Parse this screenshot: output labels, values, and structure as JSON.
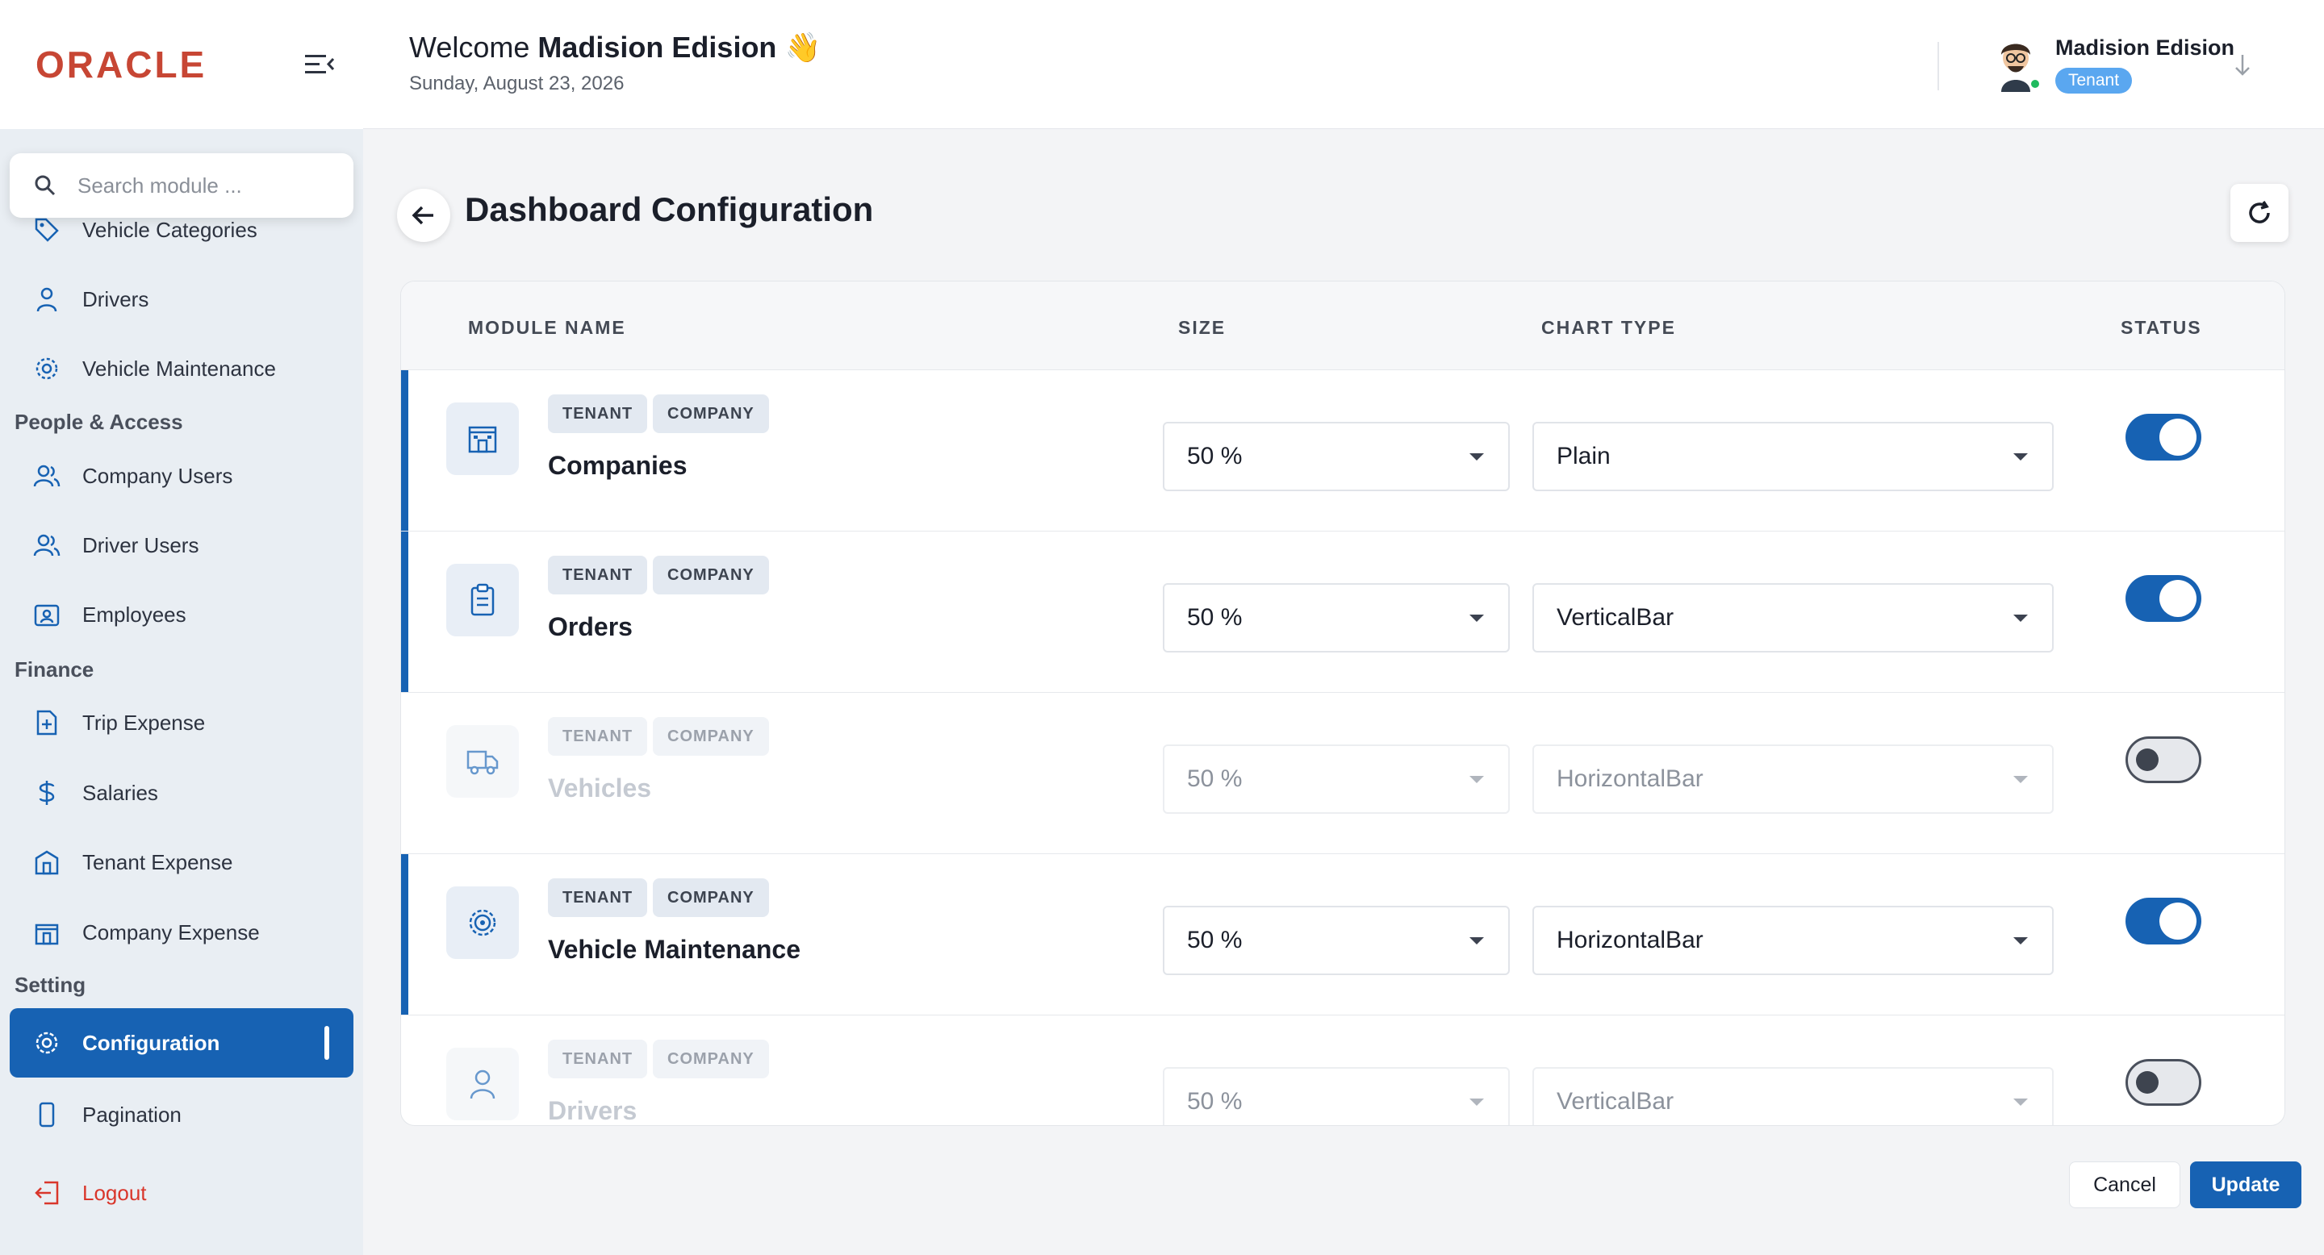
{
  "app": {
    "logo": "ORACLE"
  },
  "search": {
    "placeholder": "Search module ..."
  },
  "sidebar": {
    "items": [
      {
        "label": "Vehicle Categories",
        "icon": "tag-icon"
      },
      {
        "label": "Drivers",
        "icon": "user-icon"
      },
      {
        "label": "Vehicle Maintenance",
        "icon": "gear-icon"
      }
    ],
    "sections": {
      "people": "People & Access",
      "finance": "Finance",
      "setting": "Setting"
    },
    "people_items": [
      {
        "label": "Company Users",
        "icon": "users-icon"
      },
      {
        "label": "Driver Users",
        "icon": "users-icon"
      },
      {
        "label": "Employees",
        "icon": "id-card-icon"
      }
    ],
    "finance_items": [
      {
        "label": "Trip Expense",
        "icon": "file-plus-icon"
      },
      {
        "label": "Salaries",
        "icon": "dollar-icon"
      },
      {
        "label": "Tenant Expense",
        "icon": "building-icon"
      },
      {
        "label": "Company Expense",
        "icon": "building-icon"
      }
    ],
    "setting_items": [
      {
        "label": "Configuration",
        "icon": "settings-icon",
        "active": true
      },
      {
        "label": "Pagination",
        "icon": "phone-icon"
      }
    ],
    "logout": "Logout"
  },
  "header": {
    "welcome_prefix": "Welcome",
    "welcome_name": "Madision Edision",
    "wave": "👋",
    "date": "Sunday, August 23, 2026",
    "user_name": "Madision Edision",
    "user_role": "Tenant"
  },
  "page": {
    "title": "Dashboard Configuration"
  },
  "table": {
    "headers": {
      "module": "MODULE NAME",
      "size": "SIZE",
      "chart": "CHART TYPE",
      "status": "STATUS"
    },
    "rows": [
      {
        "name": "Companies",
        "tags": [
          "TENANT",
          "COMPANY"
        ],
        "size": "50 %",
        "chart": "Plain",
        "status": true,
        "icon": "building-icon"
      },
      {
        "name": "Orders",
        "tags": [
          "TENANT",
          "COMPANY"
        ],
        "size": "50 %",
        "chart": "VerticalBar",
        "status": true,
        "icon": "clipboard-icon"
      },
      {
        "name": "Vehicles",
        "tags": [
          "TENANT",
          "COMPANY"
        ],
        "size": "50 %",
        "chart": "HorizontalBar",
        "status": false,
        "icon": "truck-icon"
      },
      {
        "name": "Vehicle Maintenance",
        "tags": [
          "TENANT",
          "COMPANY"
        ],
        "size": "50 %",
        "chart": "HorizontalBar",
        "status": true,
        "icon": "gear-icon"
      },
      {
        "name": "Drivers",
        "tags": [
          "TENANT",
          "COMPANY"
        ],
        "size": "50 %",
        "chart": "VerticalBar",
        "status": false,
        "icon": "user-icon"
      }
    ]
  },
  "actions": {
    "cancel": "Cancel",
    "update": "Update"
  },
  "colors": {
    "primary": "#1762b3",
    "brand": "#c74634",
    "logout": "#d9362b",
    "online": "#1fba5e",
    "badge": "#5aa7f0"
  }
}
